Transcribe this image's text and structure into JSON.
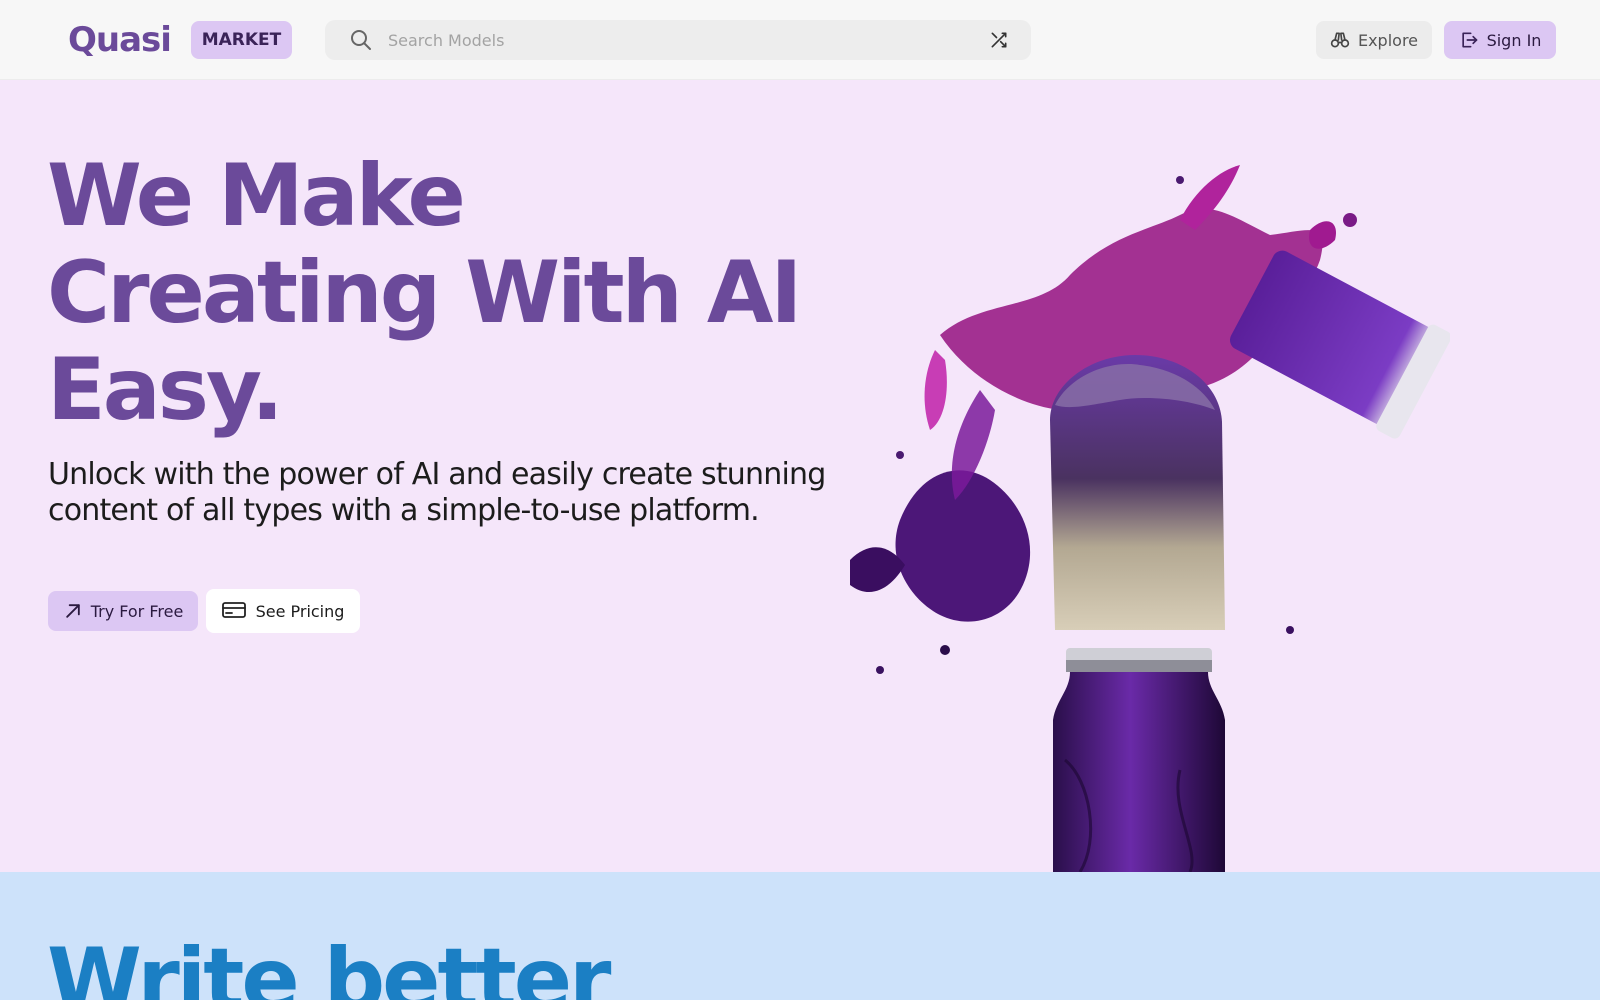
{
  "header": {
    "logo": "Quasi",
    "badge": "MARKET",
    "search": {
      "placeholder": "Search Models",
      "icon": "search-icon",
      "action_icon": "shuffle-icon"
    },
    "explore_label": "Explore",
    "signin_label": "Sign In"
  },
  "hero": {
    "title_lines": [
      "We Make",
      "Creating With AI",
      "Easy."
    ],
    "subtitle": "Unlock with the power of AI and easily create stunning content of all types with a simple-to-use platform.",
    "try_label": "Try For Free",
    "pricing_label": "See Pricing"
  },
  "section2": {
    "title_partial": "Write better"
  },
  "colors": {
    "accent": "#dcc7f3",
    "brand_purple": "#6b4a9a",
    "hero_bg": "#f5e6fa",
    "section2_bg": "#cde2fa",
    "section2_title": "#1b7fc4"
  }
}
